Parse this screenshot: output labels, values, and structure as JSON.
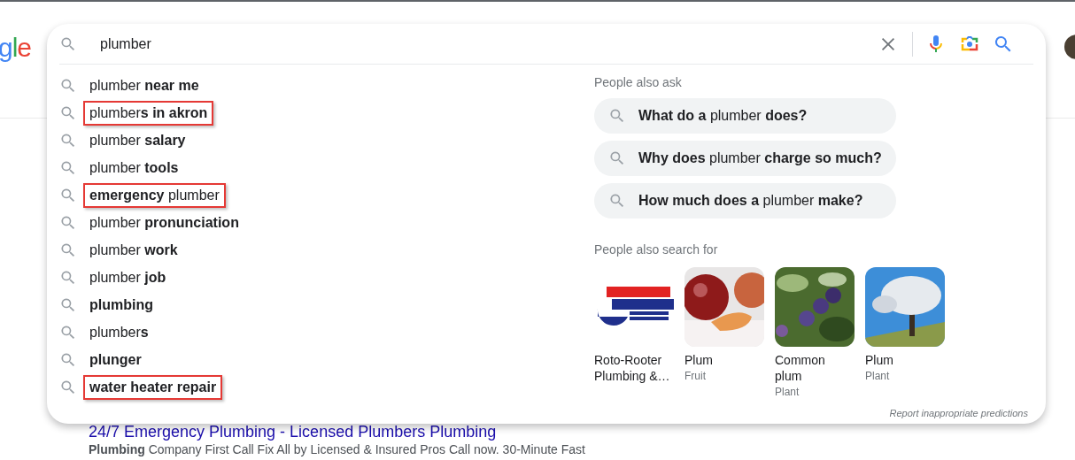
{
  "logo": {
    "letters": [
      {
        "char": "g",
        "color": "#4285f4"
      },
      {
        "char": "l",
        "color": "#34a853"
      },
      {
        "char": "e",
        "color": "#ea4335"
      }
    ]
  },
  "search": {
    "value": "plumber"
  },
  "suggestions": [
    {
      "text": "plumber **near me**",
      "highlighted": false
    },
    {
      "text": "plumber**s in akron**",
      "highlighted": true
    },
    {
      "text": "plumber **salary**",
      "highlighted": false
    },
    {
      "text": "plumber **tools**",
      "highlighted": false
    },
    {
      "text": "**emergency** plumber",
      "highlighted": true
    },
    {
      "text": "plumber **pronunciation**",
      "highlighted": false
    },
    {
      "text": "plumber **work**",
      "highlighted": false
    },
    {
      "text": "plumber **job**",
      "highlighted": false
    },
    {
      "text": "**plumbing**",
      "highlighted": false
    },
    {
      "text": "plumber**s**",
      "highlighted": false
    },
    {
      "text": "**plunger**",
      "highlighted": false
    },
    {
      "text": "**water heater repair**",
      "highlighted": true
    }
  ],
  "people_also_ask": {
    "title": "People also ask",
    "questions": [
      "**What do a** plumber **does?**",
      "**Why does** plumber **charge so much?**",
      "**How much does a** plumber **make?**"
    ]
  },
  "people_also_search": {
    "title": "People also search for",
    "items": [
      {
        "kind": "logo",
        "name": "Roto-Rooter Plumbing &…"
      },
      {
        "kind": "fruit",
        "name": "Plum",
        "subtitle": "Fruit"
      },
      {
        "kind": "branch",
        "name": "Common plum",
        "subtitle": "Plant"
      },
      {
        "kind": "tree",
        "name": "Plum",
        "subtitle": "Plant"
      }
    ]
  },
  "report_link": "Report inappropriate predictions",
  "result": {
    "title": "24/7 Emergency Plumbing - Licensed Plumbers Plumbing",
    "snippet": "**Plumbing** Company First Call Fix All by Licensed & Insured Pros Call now. 30-Minute Fast"
  }
}
